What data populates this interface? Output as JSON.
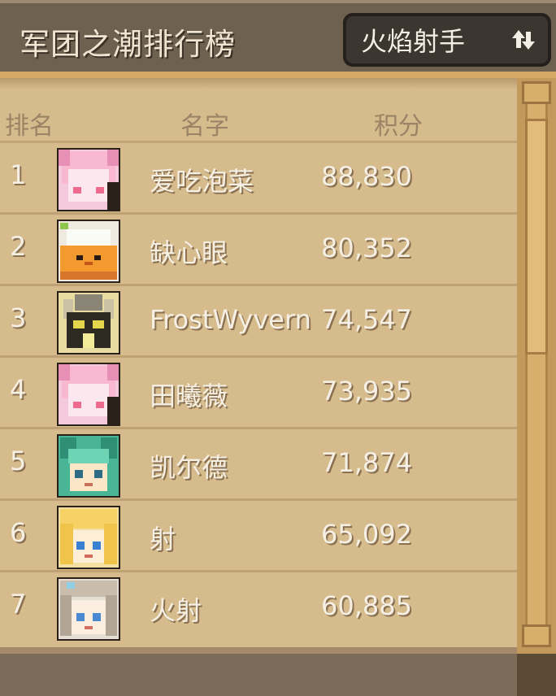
{
  "header": {
    "title": "军团之潮排行榜",
    "faction_label": "火焰射手"
  },
  "columns": {
    "rank": "排名",
    "name": "名字",
    "score": "积分"
  },
  "rows": [
    {
      "rank": "1",
      "name": "爱吃泡菜",
      "score": "88,830",
      "avatar": "pink-hair-girl"
    },
    {
      "rank": "2",
      "name": "缺心眼",
      "score": "80,352",
      "avatar": "orange-pudding-creature"
    },
    {
      "rank": "3",
      "name": "FrostWyvern",
      "score": "74,547",
      "avatar": "horned-knight"
    },
    {
      "rank": "4",
      "name": "田曦薇",
      "score": "73,935",
      "avatar": "pink-hair-girl"
    },
    {
      "rank": "5",
      "name": "凯尔德",
      "score": "71,874",
      "avatar": "green-hair-girl"
    },
    {
      "rank": "6",
      "name": "射",
      "score": "65,092",
      "avatar": "blonde-girl"
    },
    {
      "rank": "7",
      "name": "火射",
      "score": "60,885",
      "avatar": "silver-hair-girl"
    }
  ],
  "colors": {
    "panel": "#d6bb8c",
    "header": "#6f6150",
    "text": "#f5efe4"
  }
}
